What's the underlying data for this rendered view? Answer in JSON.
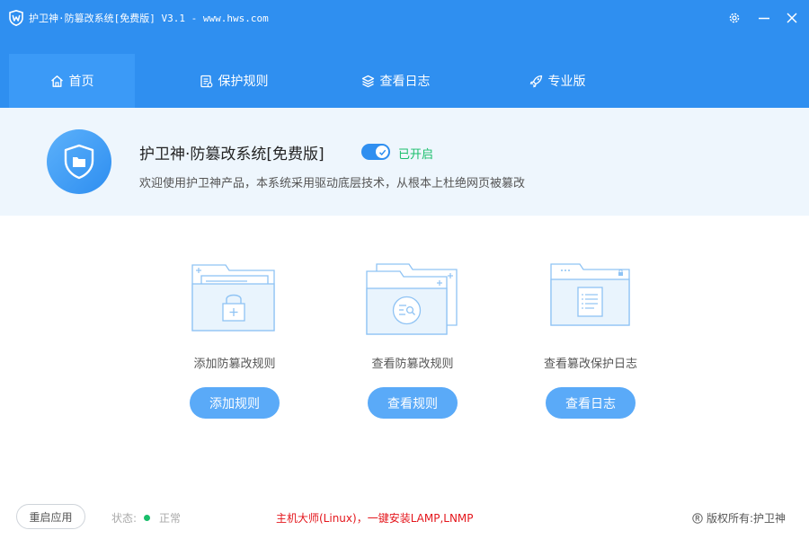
{
  "window": {
    "title": "护卫神·防篡改系统[免费版] V3.1 - www.hws.com"
  },
  "nav": {
    "tabs": [
      {
        "label": "首页",
        "icon": "home-icon",
        "active": true
      },
      {
        "label": "保护规则",
        "icon": "rules-doc-icon",
        "active": false
      },
      {
        "label": "查看日志",
        "icon": "layers-icon",
        "active": false
      },
      {
        "label": "专业版",
        "icon": "rocket-icon",
        "active": false
      }
    ]
  },
  "banner": {
    "product_name": "护卫神·防篡改系统[免费版]",
    "toggle_on": true,
    "toggle_status": "已开启",
    "description": "欢迎使用护卫神产品，本系统采用驱动底层技术，从根本上杜绝网页被篡改"
  },
  "cards": [
    {
      "label": "添加防篡改规则",
      "button": "添加规则",
      "icon": "folder-lock-icon"
    },
    {
      "label": "查看防篡改规则",
      "button": "查看规则",
      "icon": "folders-search-icon"
    },
    {
      "label": "查看篡改保护日志",
      "button": "查看日志",
      "icon": "folder-log-icon"
    }
  ],
  "footer": {
    "restart_button": "重启应用",
    "status_label": "状态:",
    "status_value": "正常",
    "promo_link": "主机大师(Linux)，一键安装LAMP,LNMP",
    "copyright": "版权所有:护卫神"
  },
  "colors": {
    "primary": "#2f8ff0",
    "active_tab": "#3b9af7",
    "banner_bg": "#eef6fd",
    "button": "#5aaaf8",
    "status_green": "#19be6b",
    "promo_red": "#e4161c"
  }
}
